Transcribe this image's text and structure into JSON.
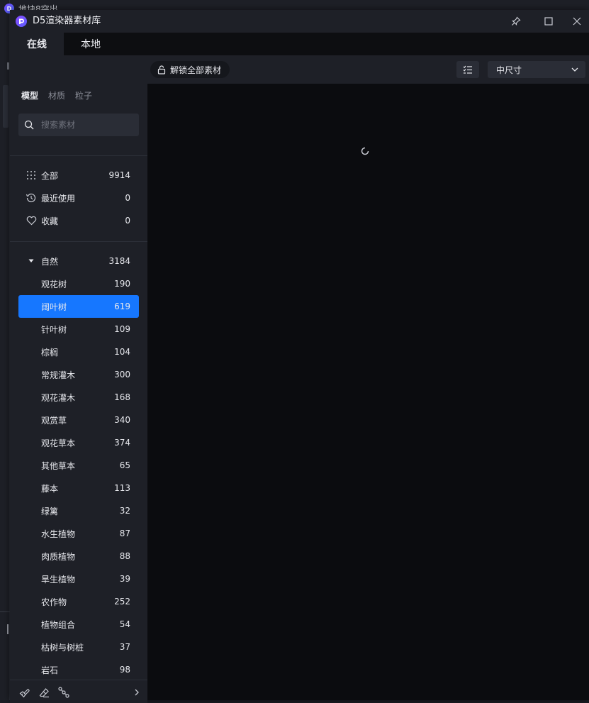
{
  "background_app": {
    "title": "地块8突出"
  },
  "window": {
    "title": "D5渲染器素材库"
  },
  "tabs": [
    {
      "label": "在线",
      "active": true
    },
    {
      "label": "本地",
      "active": false
    }
  ],
  "toolbar": {
    "unlock_label": "解锁全部素材",
    "size_select_value": "中尺寸"
  },
  "sidebar": {
    "category_tabs": [
      {
        "label": "模型",
        "active": true
      },
      {
        "label": "材质",
        "active": false
      },
      {
        "label": "粒子",
        "active": false
      }
    ],
    "search_placeholder": "搜索素材",
    "quick_items": [
      {
        "label": "全部",
        "count": "9914",
        "icon": "grid-dots-icon"
      },
      {
        "label": "最近使用",
        "count": "0",
        "icon": "history-icon"
      },
      {
        "label": "收藏",
        "count": "0",
        "icon": "heart-icon"
      }
    ],
    "group": {
      "label": "自然",
      "count": "3184",
      "expanded": true
    },
    "sub_items": [
      {
        "label": "观花树",
        "count": "190"
      },
      {
        "label": "阔叶树",
        "count": "619",
        "selected": true
      },
      {
        "label": "针叶树",
        "count": "109"
      },
      {
        "label": "棕榈",
        "count": "104"
      },
      {
        "label": "常规灌木",
        "count": "300"
      },
      {
        "label": "观花灌木",
        "count": "168"
      },
      {
        "label": "观赏草",
        "count": "340"
      },
      {
        "label": "观花草本",
        "count": "374"
      },
      {
        "label": "其他草本",
        "count": "65"
      },
      {
        "label": "藤本",
        "count": "113"
      },
      {
        "label": "绿篱",
        "count": "32"
      },
      {
        "label": "水生植物",
        "count": "87"
      },
      {
        "label": "肉质植物",
        "count": "88"
      },
      {
        "label": "旱生植物",
        "count": "39"
      },
      {
        "label": "农作物",
        "count": "252"
      },
      {
        "label": "植物组合",
        "count": "54"
      },
      {
        "label": "枯树与树桩",
        "count": "37"
      },
      {
        "label": "岩石",
        "count": "98"
      }
    ]
  },
  "colors": {
    "accent": "#1677ff",
    "panel": "#1e2027",
    "content_bg": "#0b0c0f"
  }
}
